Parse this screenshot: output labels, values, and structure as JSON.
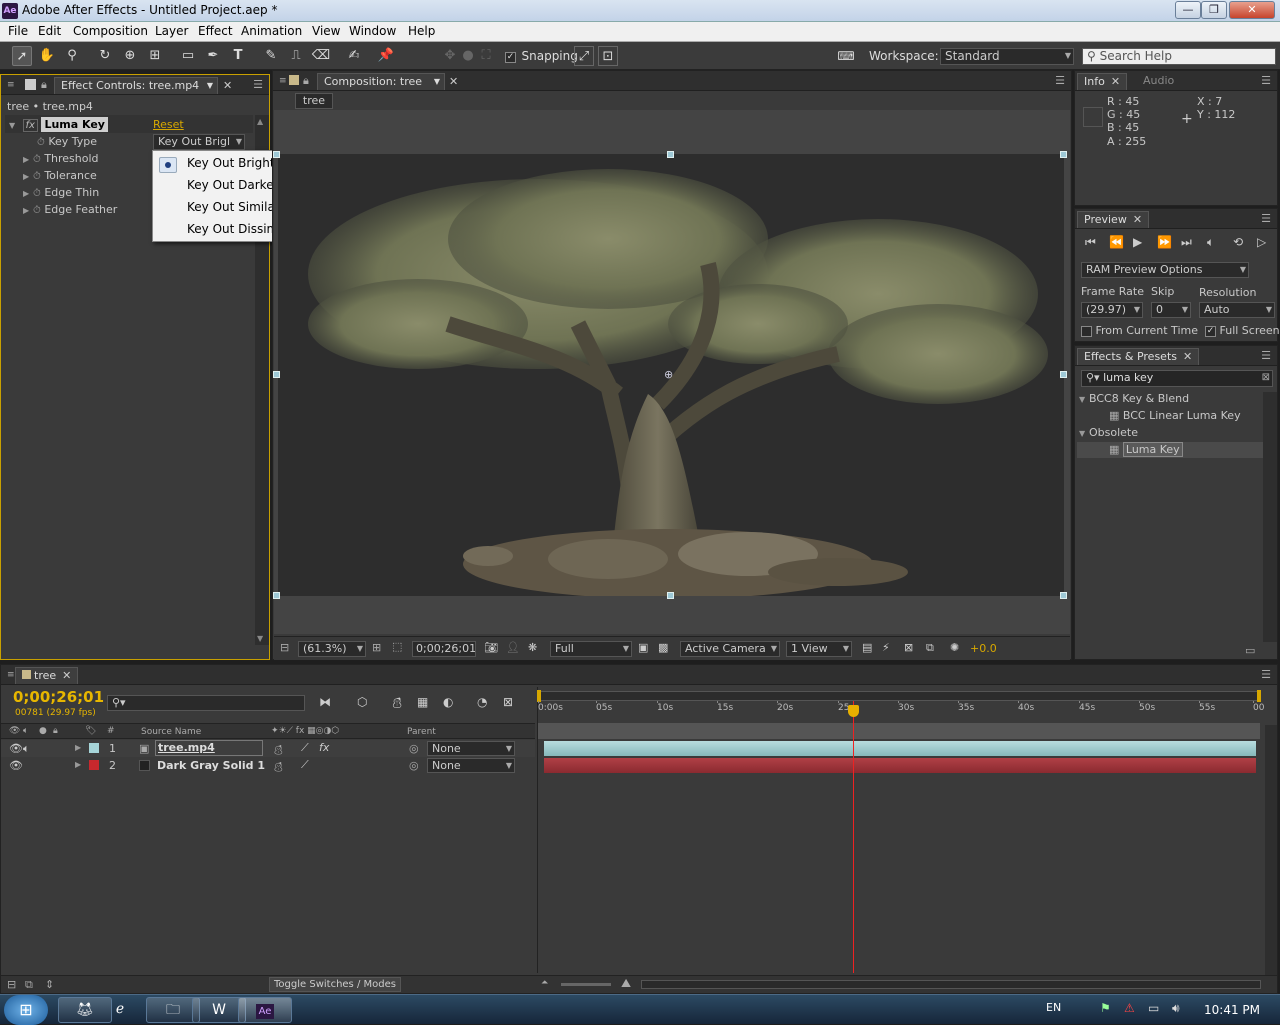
{
  "window": {
    "title": "Adobe After Effects - Untitled Project.aep *",
    "app_icon": "Ae",
    "controls": {
      "minimize": "—",
      "maximize": "❐",
      "close": "✕"
    }
  },
  "menu": [
    "File",
    "Edit",
    "Composition",
    "Layer",
    "Effect",
    "Animation",
    "View",
    "Window",
    "Help"
  ],
  "toolbar": {
    "snapping_label": "Snapping",
    "workspace_label": "Workspace:",
    "workspace_value": "Standard",
    "search_placeholder": "Search Help"
  },
  "effect_controls": {
    "tab_label": "Effect Controls: tree.mp4",
    "breadcrumb": "tree • tree.mp4",
    "effect_name": "Luma Key",
    "reset_label": "Reset",
    "properties": [
      {
        "label": "Key Type",
        "value": "Key Out Brigl"
      },
      {
        "label": "Threshold"
      },
      {
        "label": "Tolerance"
      },
      {
        "label": "Edge Thin"
      },
      {
        "label": "Edge Feather"
      }
    ],
    "dropdown_options": [
      "Key Out Brighter",
      "Key Out Darker",
      "Key Out Similar",
      "Key Out Dissimilar"
    ],
    "dropdown_selected": "Key Out Brighter"
  },
  "composition": {
    "tab_label": "Composition: tree",
    "comp_name_tab": "tree",
    "zoom": "(61.3%)",
    "timecode": "0;00;26;01",
    "resolution": "Full",
    "camera": "Active Camera",
    "views": "1 View",
    "exposure": "+0.0"
  },
  "info": {
    "tabs": [
      "Info",
      "Audio"
    ],
    "r": "R : 45",
    "g": "G : 45",
    "b": "B : 45",
    "a": "A : 255",
    "x": "X : 7",
    "y": "Y : 112",
    "swatch_color": "#2d2d2d"
  },
  "preview": {
    "tab_label": "Preview",
    "ram_options": "RAM Preview Options",
    "frame_rate_label": "Frame Rate",
    "skip_label": "Skip",
    "resolution_label": "Resolution",
    "frame_rate_value": "(29.97)",
    "skip_value": "0",
    "resolution_value": "Auto",
    "from_current_time": "From Current Time",
    "full_screen": "Full Screen"
  },
  "effects_presets": {
    "tab_label": "Effects & Presets",
    "search_value": "luma key",
    "groups": [
      {
        "name": "BCC8 Key & Blend",
        "items": [
          "BCC Linear Luma Key"
        ]
      },
      {
        "name": "Obsolete",
        "items": [
          "Luma Key"
        ]
      }
    ]
  },
  "timeline": {
    "tab_label": "tree",
    "timecode": "0;00;26;01",
    "frame_info": "00781 (29.97 fps)",
    "column_headers": {
      "number": "#",
      "source_name": "Source Name",
      "parent": "Parent"
    },
    "layers": [
      {
        "num": "1",
        "name": "tree.mp4",
        "parent": "None",
        "label_color": "#a6d4d8"
      },
      {
        "num": "2",
        "name": "Dark Gray Solid 1",
        "parent": "None",
        "label_color": "#c8282d"
      }
    ],
    "ruler_ticks": [
      "0:00s",
      "05s",
      "10s",
      "15s",
      "20s",
      "25s",
      "30s",
      "35s",
      "40s",
      "45s",
      "50s",
      "55s",
      "00"
    ],
    "toggle_label": "Toggle Switches / Modes"
  },
  "taskbar": {
    "lang": "EN",
    "clock": "10:41 PM",
    "apps": [
      "firefox-icon",
      "ie-icon",
      "explorer-icon",
      "word-icon",
      "after-effects-icon"
    ]
  }
}
